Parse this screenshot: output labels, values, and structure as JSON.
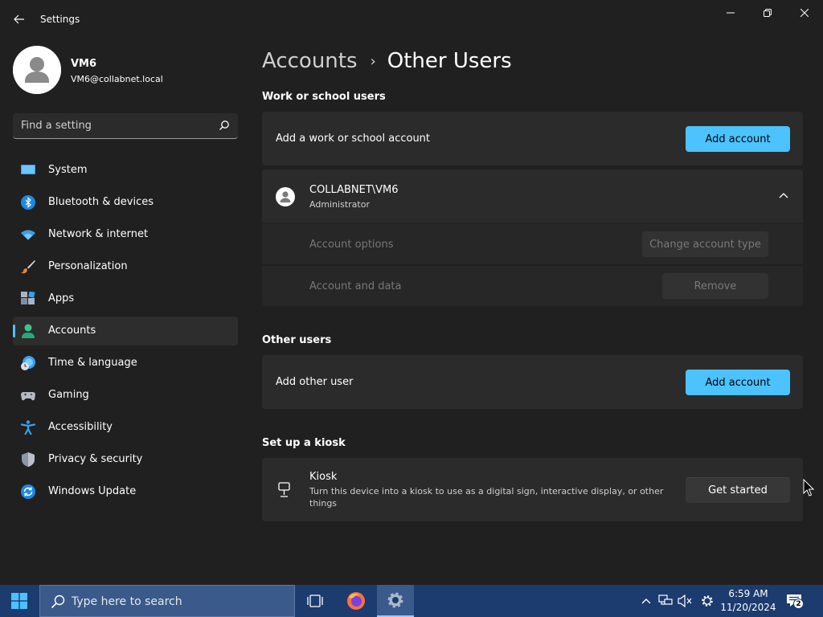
{
  "window": {
    "title": "Settings",
    "back_label": "Back",
    "minimize_label": "Minimize",
    "maximize_label": "Restore",
    "close_label": "Close"
  },
  "profile": {
    "name": "VM6",
    "email": "VM6@collabnet.local"
  },
  "search": {
    "placeholder": "Find a setting"
  },
  "sidebar": {
    "items": [
      {
        "label": "System",
        "icon": "system-icon",
        "selected": false
      },
      {
        "label": "Bluetooth & devices",
        "icon": "bluetooth-icon",
        "selected": false
      },
      {
        "label": "Network & internet",
        "icon": "wifi-icon",
        "selected": false
      },
      {
        "label": "Personalization",
        "icon": "brush-icon",
        "selected": false
      },
      {
        "label": "Apps",
        "icon": "apps-icon",
        "selected": false
      },
      {
        "label": "Accounts",
        "icon": "account-icon",
        "selected": true
      },
      {
        "label": "Time & language",
        "icon": "clock-globe-icon",
        "selected": false
      },
      {
        "label": "Gaming",
        "icon": "gamepad-icon",
        "selected": false
      },
      {
        "label": "Accessibility",
        "icon": "accessibility-icon",
        "selected": false
      },
      {
        "label": "Privacy & security",
        "icon": "shield-icon",
        "selected": false
      },
      {
        "label": "Windows Update",
        "icon": "update-icon",
        "selected": false
      }
    ]
  },
  "breadcrumb": {
    "parent": "Accounts",
    "separator": "›",
    "current": "Other Users"
  },
  "work_school": {
    "title": "Work or school users",
    "add_text": "Add a work or school account",
    "add_button": "Add account",
    "user": {
      "name": "COLLABNET\\VM6",
      "role": "Administrator",
      "options_label": "Account options",
      "options_button": "Change account type",
      "data_label": "Account and data",
      "data_button": "Remove"
    }
  },
  "other_users": {
    "title": "Other users",
    "add_text": "Add other user",
    "add_button": "Add account"
  },
  "kiosk": {
    "title": "Set up a kiosk",
    "name": "Kiosk",
    "description": "Turn this device into a kiosk to use as a digital sign, interactive display, or other things",
    "button": "Get started"
  },
  "taskbar": {
    "search_placeholder": "Type here to search",
    "time": "6:59 AM",
    "date": "11/20/2024",
    "notification_count": "2"
  },
  "colors": {
    "accent": "#4cc2ff",
    "background": "#202020",
    "card": "#2b2b2b",
    "taskbar": "#1c3b6e"
  }
}
